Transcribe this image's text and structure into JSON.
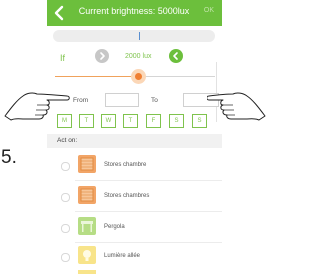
{
  "header": {
    "title": "Current brightness: 5000lux",
    "ok_label": "OK",
    "accent": "#6cbf3c"
  },
  "condition": {
    "if_label": "If",
    "value": "2000 lux",
    "minus_label": ">",
    "plus_label": "<"
  },
  "slider": {
    "level": 0.52,
    "accent": "#f07f32"
  },
  "time": {
    "from_label": "From",
    "from_value": "",
    "to_label": "To",
    "to_value": ""
  },
  "days": [
    "M",
    "T",
    "W",
    "T",
    "F",
    "S",
    "S"
  ],
  "section": {
    "act_on_label": "Act on:"
  },
  "items": [
    {
      "label": "Stores chambre",
      "icon": "blind-icon",
      "color": "#f0a060"
    },
    {
      "label": "Stores chambres",
      "icon": "blind-icon",
      "color": "#f0a060"
    },
    {
      "label": "Pergola",
      "icon": "pergola-icon",
      "color": "#a8d870"
    },
    {
      "label": "Lumière allée",
      "icon": "light-icon",
      "color": "#f7e27a"
    }
  ],
  "annotation": {
    "step_label": "5."
  }
}
